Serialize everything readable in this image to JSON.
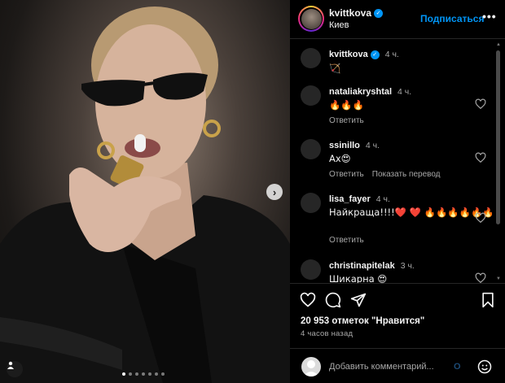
{
  "header": {
    "username": "kvittkova",
    "location": "Киев",
    "follow_label": "Подписаться",
    "more_label": "•••",
    "verified_mark": "✓"
  },
  "caption": {
    "username": "kvittkova",
    "time": "4 ч.",
    "text": "🏹"
  },
  "comments": [
    {
      "username": "nataliakryshtal",
      "time": "4 ч.",
      "text": "🔥🔥🔥",
      "reply_label": "Ответить",
      "translate_label": ""
    },
    {
      "username": "ssinillo",
      "time": "4 ч.",
      "text": "Ах😍",
      "reply_label": "Ответить",
      "translate_label": "Показать перевод"
    },
    {
      "username": "lisa_fayer",
      "time": "4 ч.",
      "text": "Найкраща!!!!❤️ ❤️ 🔥🔥🔥🔥🔥🔥",
      "reply_label": "Ответить",
      "translate_label": ""
    },
    {
      "username": "christinapitelak",
      "time": "3 ч.",
      "text": "Шикарна 😍",
      "reply_label": "",
      "translate_label": ""
    }
  ],
  "post": {
    "likes_text": "20 953 отметок \"Нравится\"",
    "time_ago": "4 часов назад",
    "carousel_total": 7,
    "carousel_active": 1
  },
  "add_comment": {
    "placeholder": "Добавить комментарий...",
    "publish_label": "О"
  },
  "icons": {
    "like": "heart-icon",
    "comment": "comment-icon",
    "share": "paper-plane-icon",
    "save": "bookmark-icon",
    "emoji": "smiley-icon",
    "next": "chevron-right-icon",
    "user_tag": "user-icon"
  },
  "colors": {
    "accent": "#0095f6",
    "background": "#000000",
    "muted_text": "#a8a8a8",
    "divider": "#262626"
  }
}
